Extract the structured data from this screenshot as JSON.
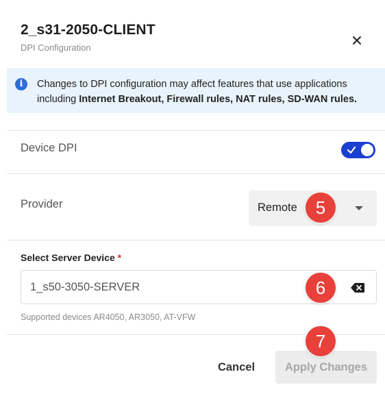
{
  "dialog": {
    "title": "2_s31-2050-CLIENT",
    "subtitle": "DPI Configuration",
    "close_icon": "close-icon"
  },
  "banner": {
    "icon": "info-icon",
    "icon_glyph": "i",
    "text_prefix": "Changes to DPI configuration may affect features that use applications including ",
    "bold_features": "Internet Breakout, Firewall rules, NAT rules, SD-WAN rules."
  },
  "device_dpi": {
    "label": "Device DPI",
    "enabled": true
  },
  "provider": {
    "label": "Provider",
    "selected": "Remote"
  },
  "server_device": {
    "label": "Select Server Device",
    "required_mark": "*",
    "value": "1_s50-3050-SERVER",
    "clear_icon": "backspace-clear-icon",
    "helper": "Supported devices AR4050, AR3050, AT-VFW"
  },
  "actions": {
    "cancel_label": "Cancel",
    "apply_label": "Apply Changes"
  },
  "annotations": {
    "marker_5": "5",
    "marker_6": "6",
    "marker_7": "7"
  },
  "colors": {
    "accent": "#1a3fd1",
    "info_banner_bg": "#e9f3fb",
    "info_icon": "#2d6cdf",
    "required": "#d93025",
    "marker": "#e8403a",
    "disabled_text": "#a7a7a7"
  }
}
